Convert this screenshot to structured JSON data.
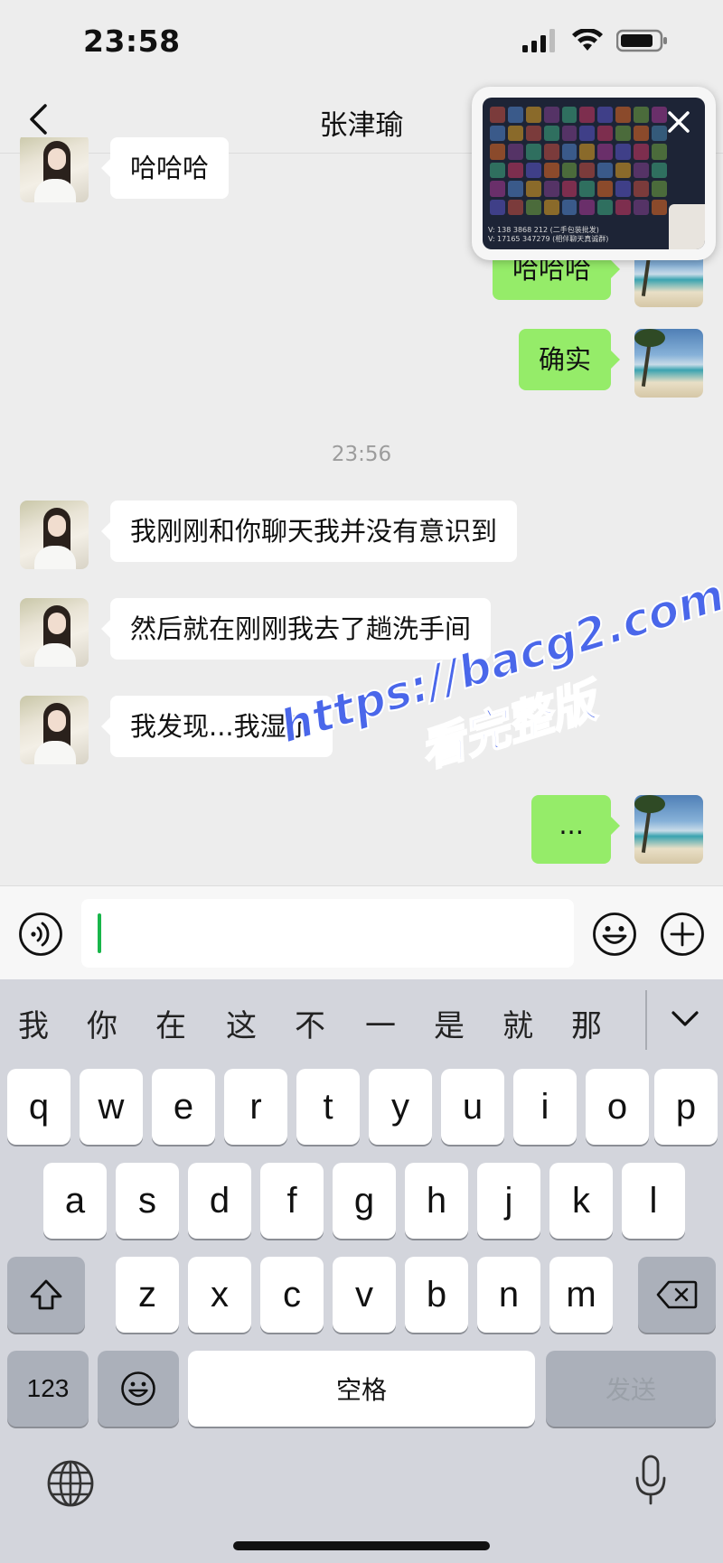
{
  "status_bar": {
    "time": "23:58"
  },
  "nav": {
    "title": "张津瑜"
  },
  "floating_window": {
    "caption_line1": "V: 138 3868 212 (二手包装批发)",
    "caption_line2": "V: 17165 347279 (相伴聊天真诚群)"
  },
  "messages": {
    "m1": "哈哈哈",
    "m2": "哈哈哈",
    "m3": "确实",
    "timestamp": "23:56",
    "m4": "我刚刚和你聊天我并没有意识到",
    "m5": "然后就在刚刚我去了趟洗手间",
    "m6": "我发现...我湿了",
    "m7": "..."
  },
  "watermark": {
    "line1": "https://bacg2.com",
    "line2": "看完整版"
  },
  "suggestions": [
    "我",
    "你",
    "在",
    "这",
    "不",
    "一",
    "是",
    "就",
    "那"
  ],
  "keyboard": {
    "row1": [
      "q",
      "w",
      "e",
      "r",
      "t",
      "y",
      "u",
      "i",
      "o",
      "p"
    ],
    "row2": [
      "a",
      "s",
      "d",
      "f",
      "g",
      "h",
      "j",
      "k",
      "l"
    ],
    "row3": [
      "z",
      "x",
      "c",
      "v",
      "b",
      "n",
      "m"
    ],
    "numbers_label": "123",
    "space_label": "空格",
    "send_label": "发送"
  },
  "colors": {
    "outgoing_bubble": "#95ec69",
    "incoming_bubble": "#ffffff",
    "background": "#ededed",
    "watermark": "#4a67ea",
    "caret": "#18b64a"
  },
  "icons": [
    "back-chevron-icon",
    "signal-icon",
    "wifi-icon",
    "battery-icon",
    "close-icon",
    "voice-icon",
    "emoji-icon",
    "plus-icon",
    "shift-icon",
    "delete-icon",
    "globe-icon",
    "microphone-icon"
  ]
}
